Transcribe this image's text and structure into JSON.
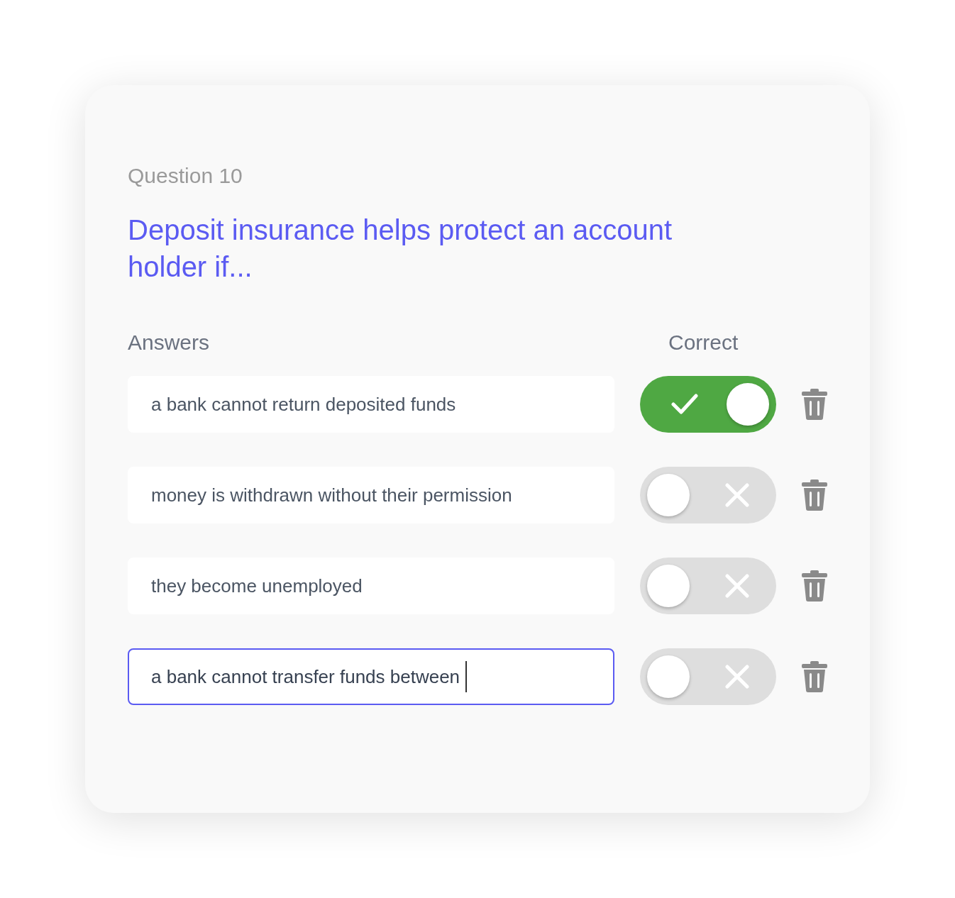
{
  "card": {
    "label": "Question 10",
    "question": "Deposit insurance helps protect an account holder if...",
    "answers_heading": "Answers",
    "correct_heading": "Correct",
    "answers": [
      {
        "text": "a bank cannot return deposited funds",
        "correct": true,
        "focused": false
      },
      {
        "text": "money is withdrawn without their permission",
        "correct": false,
        "focused": false
      },
      {
        "text": "they become unemployed",
        "correct": false,
        "focused": false
      },
      {
        "text": "a bank cannot transfer funds between",
        "correct": false,
        "focused": true
      }
    ]
  }
}
